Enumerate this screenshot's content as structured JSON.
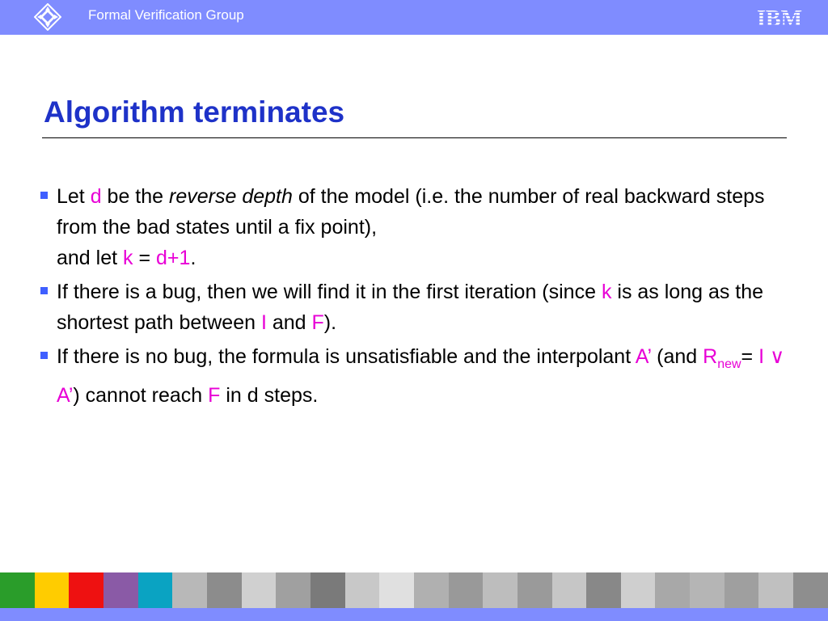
{
  "header": {
    "title": "Formal Verification Group",
    "nav_icon": "navigation-compass-icon",
    "logo_text": "IBM",
    "color": "#7f8cff"
  },
  "slide": {
    "title": "Algorithm terminates",
    "title_color": "#1e32c8",
    "highlight_color": "#e800d6",
    "bullets": [
      {
        "parts": [
          "Let ",
          "d",
          " be the ",
          "reverse depth",
          " of the model (i.e. the number of real backward steps from the bad states until a fix point),",
          "and let ",
          "k",
          " = ",
          "d+1",
          "."
        ]
      },
      {
        "parts": [
          "If there is a bug, then we will find it in the first iteration (since ",
          "k",
          " is as long as the shortest path between ",
          "I",
          " and ",
          "F",
          ")."
        ]
      },
      {
        "parts": [
          "If there is no bug, the formula is unsatisfiable and the interpolant ",
          "A’",
          " (and ",
          "R",
          "new",
          "= ",
          "I ∨ A’",
          ") cannot reach ",
          "F",
          " in d steps."
        ]
      }
    ]
  },
  "footer": {
    "strip_colors": [
      "#2a9d2a",
      "#ffcc00",
      "#ee1111",
      "#8a5aa6",
      "#0aa3c2",
      "#b8b8b8",
      "#8c8c8c",
      "#d0d0d0",
      "#a0a0a0",
      "#7a7a7a",
      "#c8c8c8",
      "#e0e0e0",
      "#b0b0b0",
      "#999999",
      "#bdbdbd",
      "#9a9a9a",
      "#c6c6c6",
      "#888888",
      "#cfcfcf",
      "#a8a8a8",
      "#b5b5b5",
      "#9f9f9f",
      "#c0c0c0",
      "#8e8e8e"
    ]
  }
}
